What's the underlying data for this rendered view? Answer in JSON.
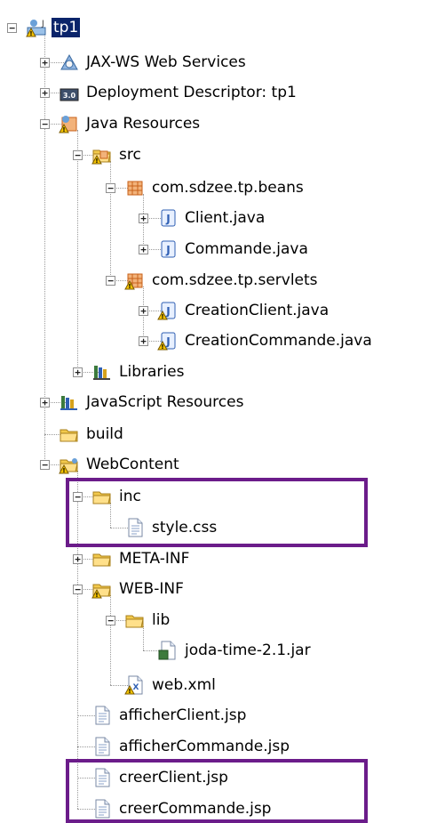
{
  "tree": {
    "nodes": [
      {
        "label": "tp1",
        "icon": "project-icon",
        "toggle": "minus",
        "selected": true
      },
      {
        "label": "JAX-WS Web Services",
        "icon": "web-services-icon",
        "toggle": "plus"
      },
      {
        "label": "Deployment Descriptor: tp1",
        "icon": "deployment-descriptor-icon",
        "toggle": "plus"
      },
      {
        "label": "Java Resources",
        "icon": "java-resources-icon",
        "toggle": "minus"
      },
      {
        "label": "src",
        "icon": "source-folder-icon",
        "toggle": "minus"
      },
      {
        "label": "com.sdzee.tp.beans",
        "icon": "package-icon",
        "toggle": "minus"
      },
      {
        "label": "Client.java",
        "icon": "java-file-icon",
        "toggle": "plus"
      },
      {
        "label": "Commande.java",
        "icon": "java-file-icon",
        "toggle": "plus"
      },
      {
        "label": "com.sdzee.tp.servlets",
        "icon": "package-warning-icon",
        "toggle": "minus"
      },
      {
        "label": "CreationClient.java",
        "icon": "java-file-warning-icon",
        "toggle": "plus"
      },
      {
        "label": "CreationCommande.java",
        "icon": "java-file-warning-icon",
        "toggle": "plus"
      },
      {
        "label": "Libraries",
        "icon": "libraries-icon",
        "toggle": "plus"
      },
      {
        "label": "JavaScript Resources",
        "icon": "javascript-resources-icon",
        "toggle": "plus"
      },
      {
        "label": "build",
        "icon": "folder-icon",
        "toggle": "none"
      },
      {
        "label": "WebContent",
        "icon": "web-content-folder-icon",
        "toggle": "minus"
      },
      {
        "label": "inc",
        "icon": "folder-icon",
        "toggle": "minus"
      },
      {
        "label": "style.css",
        "icon": "css-file-icon",
        "toggle": "none"
      },
      {
        "label": "META-INF",
        "icon": "folder-icon",
        "toggle": "plus"
      },
      {
        "label": "WEB-INF",
        "icon": "folder-warning-icon",
        "toggle": "minus"
      },
      {
        "label": "lib",
        "icon": "folder-icon",
        "toggle": "minus"
      },
      {
        "label": "joda-time-2.1.jar",
        "icon": "jar-file-icon",
        "toggle": "none"
      },
      {
        "label": "web.xml",
        "icon": "xml-file-warning-icon",
        "toggle": "none"
      },
      {
        "label": "afficherClient.jsp",
        "icon": "jsp-file-icon",
        "toggle": "none"
      },
      {
        "label": "afficherCommande.jsp",
        "icon": "jsp-file-icon",
        "toggle": "none"
      },
      {
        "label": "creerClient.jsp",
        "icon": "jsp-file-icon",
        "toggle": "none"
      },
      {
        "label": "creerCommande.jsp",
        "icon": "jsp-file-icon",
        "toggle": "none"
      }
    ]
  },
  "colors": {
    "highlight": "#6b1c8a",
    "selection": "#0a246a",
    "folder": "#f2c94c",
    "java_blue": "#2f5fb3",
    "package_orange": "#c8611a",
    "warning": "#f5c400"
  }
}
